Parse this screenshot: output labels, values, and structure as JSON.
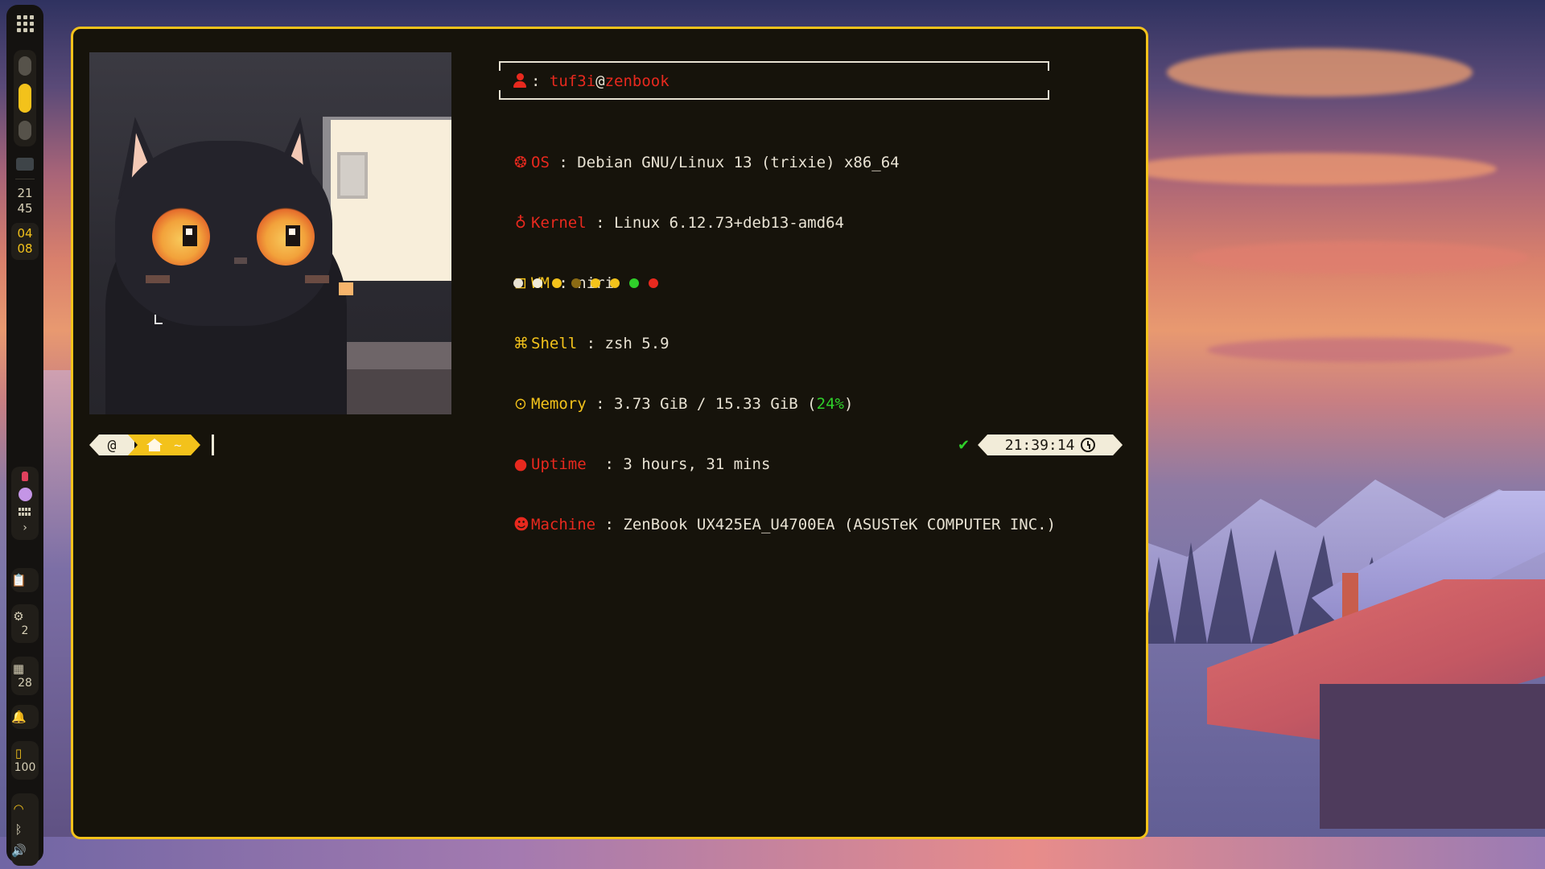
{
  "sidebar": {
    "clock_hour": "21",
    "clock_minute": "45",
    "date_month": "04",
    "date_day": "08",
    "cpu_value": "2",
    "memory_value": "28",
    "battery_value": "100",
    "accent_color": "#f3c21b"
  },
  "terminal": {
    "user": "tuf3i",
    "at": "@",
    "host": "zenbook",
    "title_sep": ":",
    "rows": [
      {
        "icon": "debian-icon",
        "label": "OS",
        "sep": " : ",
        "value": "Debian GNU/Linux 13 (trixie) x86_64"
      },
      {
        "icon": "linux-icon",
        "label": "Kernel",
        "sep": " : ",
        "value": "Linux 6.12.73+deb13-amd64"
      },
      {
        "icon": "window-manager-icon",
        "label": "WM",
        "sep": " : ",
        "value": "niri"
      },
      {
        "icon": "command-icon",
        "label": "Shell",
        "sep": " : ",
        "value": "zsh 5.9"
      },
      {
        "icon": "memory-icon",
        "label": "Memory",
        "sep": " : ",
        "value": "3.73 GiB / 15.33 GiB (",
        "highlight": "24%",
        "value_end": ")"
      },
      {
        "icon": "uptime-icon",
        "label": "Uptime",
        "sep": "  : ",
        "value": "3 hours, 31 mins"
      },
      {
        "icon": "machine-icon",
        "label": "Machine",
        "sep": " : ",
        "value": "ZenBook UX425EA_U4700EA (ASUSTeK COMPUTER INC.)"
      }
    ],
    "palette": [
      "#e8e2d3",
      "#f2ecd9",
      "#f3c21b",
      "#8a6a14",
      "#f3c21b",
      "#f3c21b",
      "#2fcf2a",
      "#e8291e"
    ],
    "prompt": {
      "dir": "~",
      "status": "✔",
      "time": "21:39:14"
    }
  }
}
